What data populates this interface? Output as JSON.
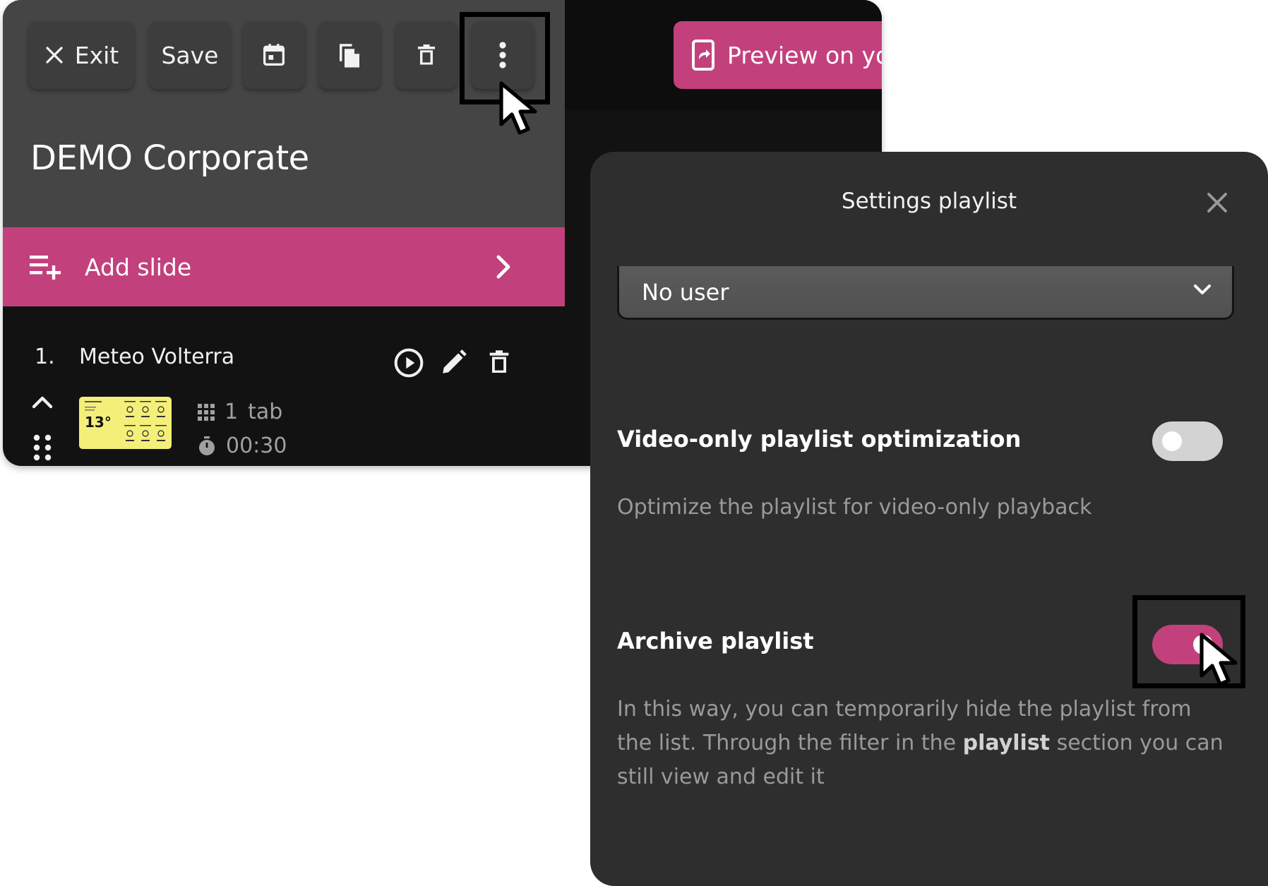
{
  "toolbar": {
    "exit_label": "Exit",
    "save_label": "Save",
    "preview_label": "Preview on you"
  },
  "playlist": {
    "title": "DEMO Corporate",
    "add_slide_label": "Add slide"
  },
  "slides": [
    {
      "number": "1.",
      "name": "Meteo Volterra",
      "thumbnail_temp": "13°",
      "tabs_count": "1",
      "tabs_label": "tab",
      "duration": "00:30"
    }
  ],
  "settings": {
    "title": "Settings playlist",
    "user_select_value": "No user",
    "video_only": {
      "title": "Video-only playlist optimization",
      "description": "Optimize the playlist for video-only playback",
      "enabled": false
    },
    "archive": {
      "title": "Archive playlist",
      "description_before": "In this way, you can temporarily hide the playlist from the list. Through the filter in the ",
      "description_bold": "playlist",
      "description_after": " section you can still view and edit it",
      "enabled": true
    }
  },
  "icons": {
    "exit": "close-icon",
    "calendar": "calendar-icon",
    "copy": "copy-icon",
    "delete": "trash-icon",
    "more": "more-vert-icon",
    "preview": "phone-share-icon",
    "add_slide": "playlist-add-icon",
    "chevron": "chevron-right-icon",
    "play": "play-circle-icon",
    "edit": "pencil-icon",
    "move_up": "chevron-up-icon",
    "drag": "drag-handle-icon",
    "grid": "grid-icon",
    "timer": "timer-icon",
    "settings_close": "close-icon",
    "select_chevron": "chevron-down-icon"
  },
  "colors": {
    "accent": "#c2417c",
    "panel_dark": "#121212",
    "panel_header": "#454545",
    "modal_bg": "#2e2e2e",
    "thumbnail_bg": "#f4ef78"
  }
}
